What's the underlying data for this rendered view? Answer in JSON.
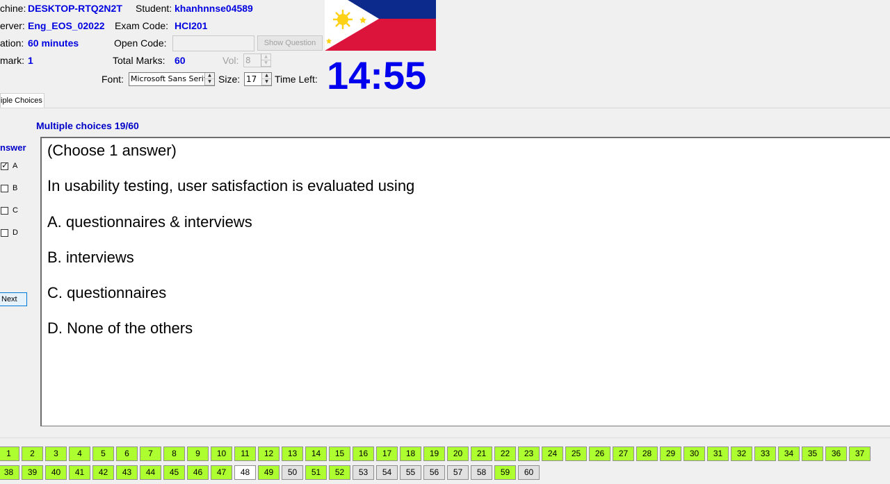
{
  "header": {
    "machine_label": "chine:",
    "machine_value": "DESKTOP-RTQ2N2T",
    "student_label": "Student:",
    "student_value": "khanhnnse04589",
    "server_label": "erver:",
    "server_value": "Eng_EOS_02022",
    "exam_code_label": "Exam Code:",
    "exam_code_value": "HCI201",
    "duration_label": "ation:",
    "duration_value": "60 minutes",
    "open_code_label": "Open Code:",
    "open_code_value": "",
    "show_question_label": "Show Question",
    "mark_label": "mark:",
    "mark_value": "1",
    "total_marks_label": "Total Marks:",
    "total_marks_value": "60",
    "vol_label": "Vol:",
    "vol_value": "8",
    "font_label": "Font:",
    "font_value": "Microsoft Sans Serif",
    "size_label": "Size:",
    "size_value": "17",
    "time_left_label": "Time Left:",
    "time_left_value": "14:55"
  },
  "tabs": [
    {
      "label": "iple Choices"
    }
  ],
  "question": {
    "title": "Multiple choices 19/60",
    "answer_heading": "nswer",
    "options": [
      {
        "key": "A",
        "checked": true
      },
      {
        "key": "B",
        "checked": false
      },
      {
        "key": "C",
        "checked": false
      },
      {
        "key": "D",
        "checked": false
      }
    ],
    "next_label": "Next",
    "lines": [
      "(Choose 1 answer)",
      "In usability testing, user satisfaction is evaluated using",
      "A.  questionnaires & interviews",
      "B.  interviews",
      "C.  questionnaires",
      "D.  None of the others"
    ]
  },
  "navigator": {
    "row1": [
      {
        "label": "1",
        "state": "answered"
      },
      {
        "label": "2",
        "state": "answered"
      },
      {
        "label": "3",
        "state": "answered"
      },
      {
        "label": "4",
        "state": "answered"
      },
      {
        "label": "5",
        "state": "answered"
      },
      {
        "label": "6",
        "state": "answered"
      },
      {
        "label": "7",
        "state": "answered"
      },
      {
        "label": "8",
        "state": "answered"
      },
      {
        "label": "9",
        "state": "answered"
      },
      {
        "label": "10",
        "state": "answered"
      },
      {
        "label": "11",
        "state": "answered"
      },
      {
        "label": "12",
        "state": "answered"
      },
      {
        "label": "13",
        "state": "answered"
      },
      {
        "label": "14",
        "state": "answered"
      },
      {
        "label": "15",
        "state": "answered"
      },
      {
        "label": "16",
        "state": "answered"
      },
      {
        "label": "17",
        "state": "answered"
      },
      {
        "label": "18",
        "state": "answered"
      },
      {
        "label": "19",
        "state": "answered"
      },
      {
        "label": "20",
        "state": "answered"
      },
      {
        "label": "21",
        "state": "answered"
      },
      {
        "label": "22",
        "state": "answered"
      },
      {
        "label": "23",
        "state": "answered"
      },
      {
        "label": "24",
        "state": "answered"
      },
      {
        "label": "25",
        "state": "answered"
      },
      {
        "label": "26",
        "state": "answered"
      },
      {
        "label": "27",
        "state": "answered"
      },
      {
        "label": "28",
        "state": "answered"
      },
      {
        "label": "29",
        "state": "answered"
      },
      {
        "label": "30",
        "state": "answered"
      },
      {
        "label": "31",
        "state": "answered"
      },
      {
        "label": "32",
        "state": "answered"
      },
      {
        "label": "33",
        "state": "answered"
      },
      {
        "label": "34",
        "state": "answered"
      },
      {
        "label": "35",
        "state": "answered"
      },
      {
        "label": "36",
        "state": "answered"
      },
      {
        "label": "37",
        "state": "answered"
      }
    ],
    "row2": [
      {
        "label": "38",
        "state": "answered"
      },
      {
        "label": "39",
        "state": "answered"
      },
      {
        "label": "40",
        "state": "answered"
      },
      {
        "label": "41",
        "state": "answered"
      },
      {
        "label": "42",
        "state": "answered"
      },
      {
        "label": "43",
        "state": "answered"
      },
      {
        "label": "44",
        "state": "answered"
      },
      {
        "label": "45",
        "state": "answered"
      },
      {
        "label": "46",
        "state": "answered"
      },
      {
        "label": "47",
        "state": "answered"
      },
      {
        "label": "48",
        "state": "current"
      },
      {
        "label": "49",
        "state": "answered"
      },
      {
        "label": "50",
        "state": "unanswered"
      },
      {
        "label": "51",
        "state": "answered"
      },
      {
        "label": "52",
        "state": "answered"
      },
      {
        "label": "53",
        "state": "unanswered"
      },
      {
        "label": "54",
        "state": "unanswered"
      },
      {
        "label": "55",
        "state": "unanswered"
      },
      {
        "label": "56",
        "state": "unanswered"
      },
      {
        "label": "57",
        "state": "unanswered"
      },
      {
        "label": "58",
        "state": "unanswered"
      },
      {
        "label": "59",
        "state": "answered"
      },
      {
        "label": "60",
        "state": "unanswered"
      }
    ]
  },
  "colors": {
    "accent_blue": "#0000e0",
    "answered": "#adff2f",
    "unanswered": "#e1e1e1"
  },
  "flag_icon": "philippines-flag"
}
